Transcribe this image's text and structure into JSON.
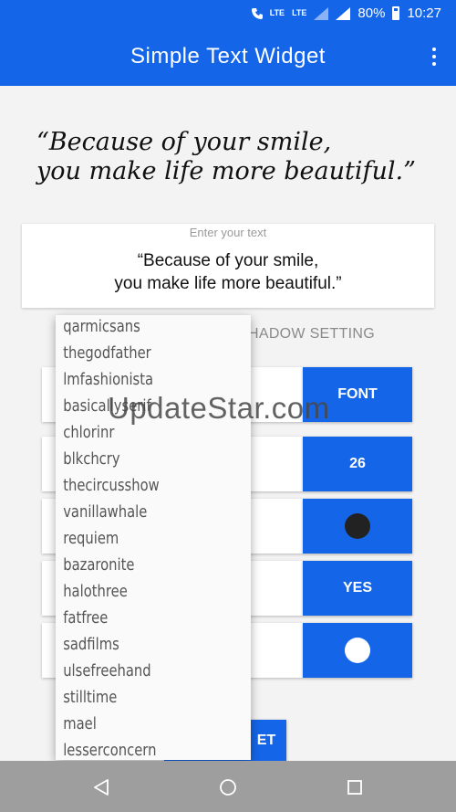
{
  "status_bar": {
    "lte_1": "LTE",
    "lte_2": "LTE",
    "battery": "80%",
    "time": "10:27"
  },
  "app_bar": {
    "title": "Simple Text Widget"
  },
  "preview": {
    "line1": "“Because of your smile,",
    "line2": "you make life more beautiful.”"
  },
  "text_input": {
    "placeholder": "Enter your text",
    "value": "“Because of your smile,\nyou make life more beautiful.”"
  },
  "tabs": {
    "shadow_setting_partial": "HADOW SETTING"
  },
  "settings": {
    "font_button": "FONT",
    "size_button": "26",
    "color_dot": "#222222",
    "shadow_button": "YES",
    "background_dot": "#ffffff"
  },
  "bottom_button": {
    "label_partial": "ET"
  },
  "font_dropdown": {
    "options": [
      "qarmicsans",
      "thegodfather",
      "lmfashionista",
      "basicallyserif",
      "chlorinr",
      "blkchcry",
      "thecircusshow",
      "vanillawhale",
      "requiem",
      "bazaronite",
      "halothree",
      "fatfree",
      "sadfilms",
      "ulsefreehand",
      "stilltime",
      "mael",
      "lesserconcern"
    ]
  },
  "watermark": "UpdateStar.com",
  "colors": {
    "accent": "#1565e8",
    "nav_bar": "#9e9e9e"
  }
}
